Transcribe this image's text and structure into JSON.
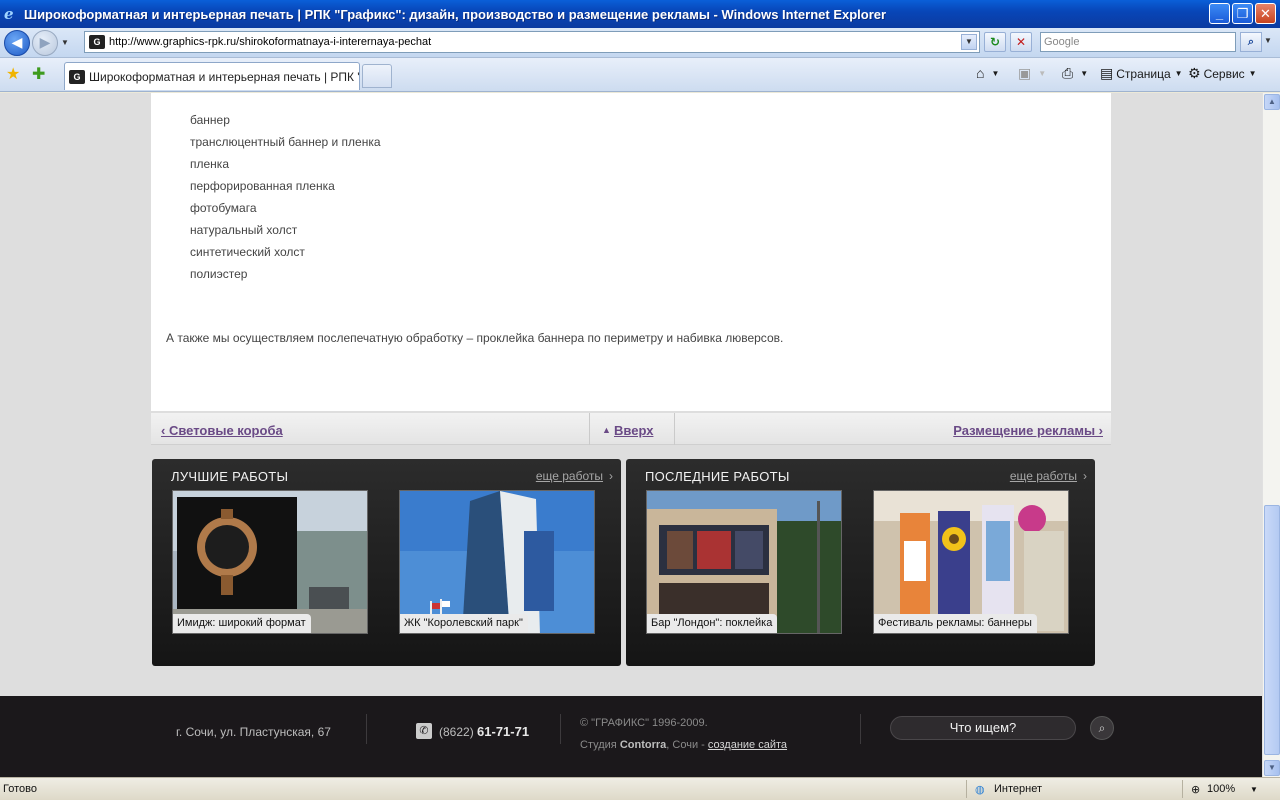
{
  "window": {
    "title": "Широкоформатная и интерьерная печать | РПК \"Графикс\": дизайн, производство и размещение рекламы - Windows Internet Explorer",
    "minimize": "_",
    "maximize": "❐",
    "close": "✕"
  },
  "address": {
    "url": "http://www.graphics-rpk.ru/shirokoformatnaya-i-interernaya-pechat",
    "search_placeholder": "Google"
  },
  "tabs": [
    {
      "label": "Широкоформатная и интерьерная печать | РПК \"Г..."
    }
  ],
  "commandbar": {
    "page_label": "Страница",
    "tools_label": "Сервис"
  },
  "content": {
    "materials": [
      "баннер",
      "транслюцентный баннер и пленка",
      "пленка",
      "перфорированная пленка",
      "фотобумага",
      "натуральный холст",
      "синтетический холст",
      "полиэстер"
    ],
    "after_text": "А также мы осуществляем послепечатную обработку – проклейка баннера по периметру и набивка люверсов."
  },
  "pager": {
    "prev": "‹ Световые короба",
    "up": "Вверх",
    "next": "Размещение рекламы ›"
  },
  "best_works": {
    "title": "ЛУЧШИЕ РАБОТЫ",
    "more": "еще работы",
    "items": [
      {
        "caption": "Имидж: широкий формат"
      },
      {
        "caption": "ЖК \"Королевский парк\""
      }
    ]
  },
  "latest_works": {
    "title": "ПОСЛЕДНИЕ РАБОТЫ",
    "more": "еще работы",
    "items": [
      {
        "caption": "Бар \"Лондон\": поклейка"
      },
      {
        "caption": "Фестиваль рекламы: баннеры"
      }
    ]
  },
  "footer": {
    "address": "г. Сочи, ул. Пластунская, 67",
    "phone_code": "(8622)",
    "phone_number": "61-71-71",
    "copyright": "© \"ГРАФИКС\" 1996-2009.",
    "studio_prefix": "Студия",
    "studio_name": "Contorra",
    "studio_city": ", Сочи - ",
    "studio_link": "создание сайта",
    "search_label": "Что ищем?"
  },
  "statusbar": {
    "status": "Готово",
    "zone": "Интернет",
    "zoom": "100%"
  }
}
